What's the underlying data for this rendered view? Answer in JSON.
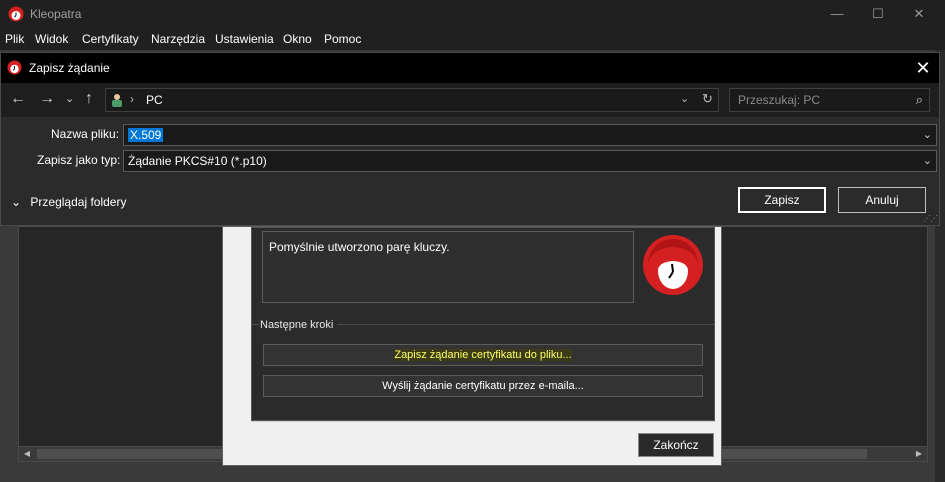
{
  "app": {
    "title": "Kleopatra",
    "window_controls": {
      "minimize": "—",
      "maximize": "☐",
      "close": "✕"
    },
    "menu": [
      "Plik",
      "Widok",
      "Certyfikaty",
      "Narzędzia",
      "Ustawienia",
      "Okno",
      "Pomoc"
    ]
  },
  "wizard": {
    "result_text": "Pomyślnie utworzono parę kluczy.",
    "next_steps_label": "Następne kroki",
    "save_request_button": "Zapisz żądanie certyfikatu do pliku...",
    "email_request_button": "Wyślij żądanie certyfikatu przez e-maila...",
    "finish_button": "Zakończ"
  },
  "save_dialog": {
    "title": "Zapisz żądanie",
    "close": "✕",
    "nav": {
      "back": "←",
      "forward": "→",
      "recent": "⌄",
      "up": "↑"
    },
    "address": {
      "separator": "›",
      "location": "PC",
      "dropdown": "⌄",
      "refresh": "↻"
    },
    "search": {
      "placeholder": "Przeszukaj: PC",
      "icon": "⌕"
    },
    "filename_label": "Nazwa pliku:",
    "filename_value": "X.509",
    "filetype_label": "Zapisz jako typ:",
    "filetype_value": "Żądanie PKCS#10 (*.p10)",
    "browse_toggle": "Przeglądaj foldery",
    "browse_chevron": "⌄",
    "field_dropdown": "⌄",
    "save_button": "Zapisz",
    "cancel_button": "Anuluj"
  },
  "scrollbar": {
    "left_arrow": "◀",
    "right_arrow": "▶"
  },
  "colors": {
    "accent": "#0078d7",
    "highlight_text": "#ffff66",
    "logo_red": "#d42020"
  }
}
